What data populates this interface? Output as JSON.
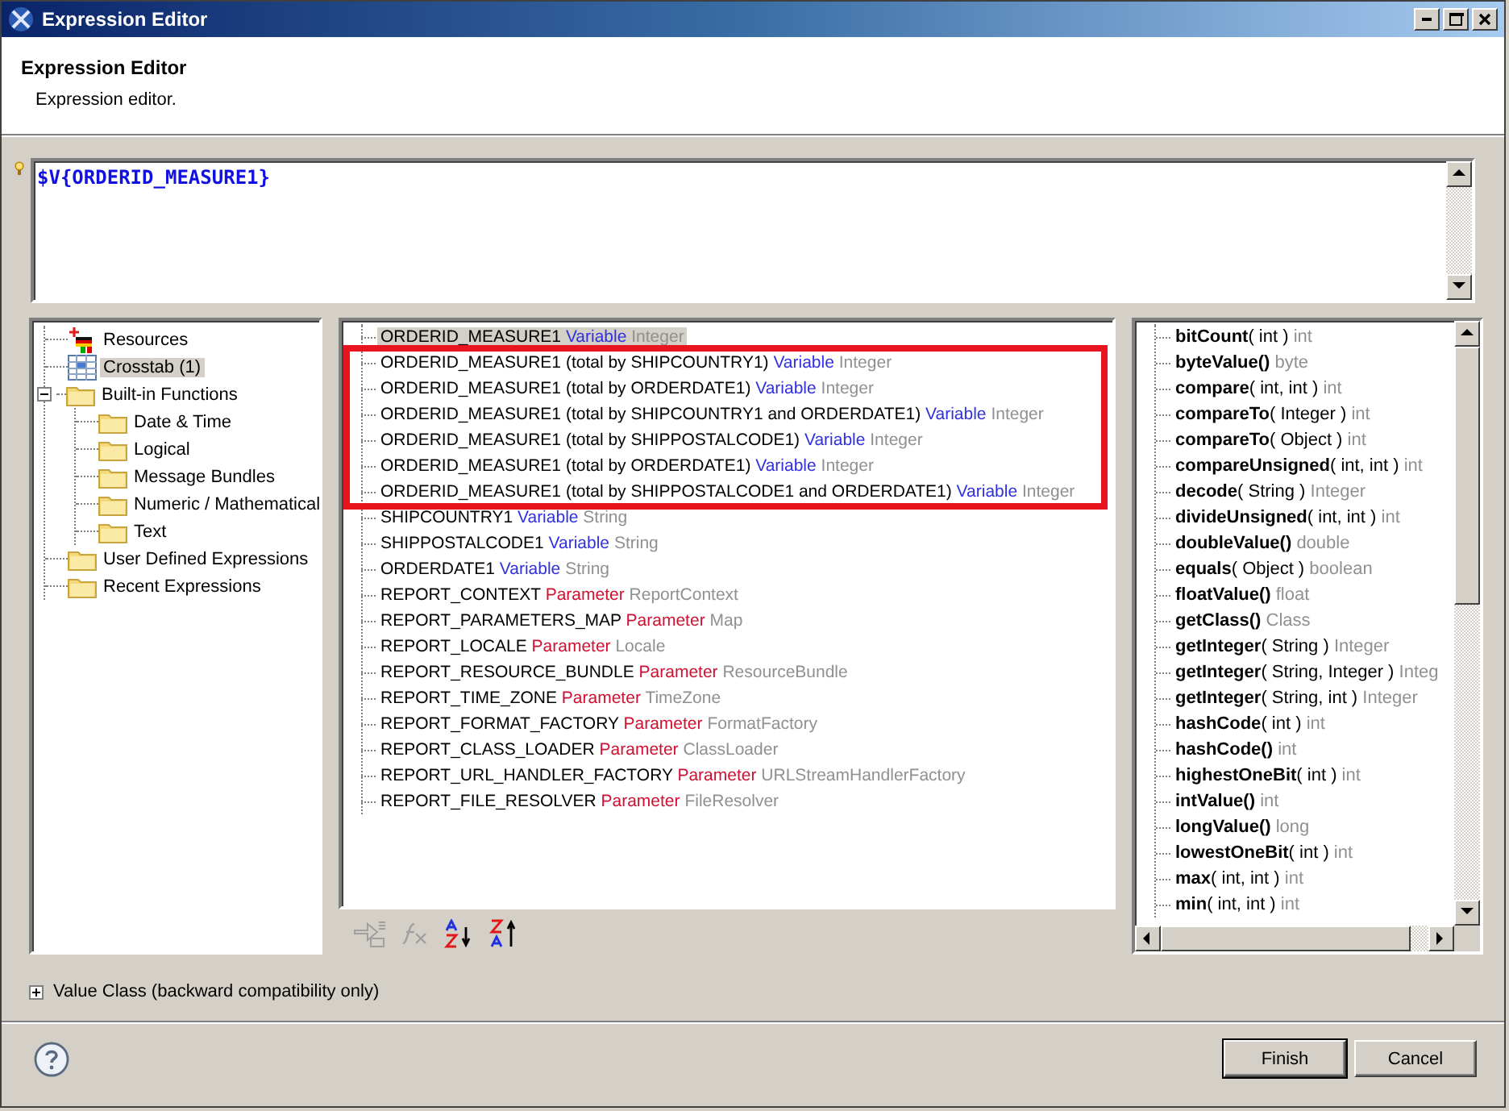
{
  "window": {
    "title": "Expression Editor"
  },
  "header": {
    "title": "Expression Editor",
    "description": "Expression editor."
  },
  "expression": {
    "value": "$V{ORDERID_MEASURE1}"
  },
  "categories": [
    {
      "label": "Resources",
      "kind": "resources",
      "selected": false
    },
    {
      "label": "Crosstab (1)",
      "kind": "crosstab",
      "selected": true
    },
    {
      "label": "Built-in Functions",
      "kind": "folder",
      "selected": false,
      "expanded": true,
      "children": [
        {
          "label": "Date & Time",
          "kind": "folder",
          "selected": false
        },
        {
          "label": "Logical",
          "kind": "folder",
          "selected": false
        },
        {
          "label": "Message Bundles",
          "kind": "folder",
          "selected": false
        },
        {
          "label": "Numeric / Mathematical",
          "kind": "folder",
          "selected": false
        },
        {
          "label": "Text",
          "kind": "folder",
          "selected": false
        }
      ]
    },
    {
      "label": "User Defined Expressions",
      "kind": "folder",
      "selected": false
    },
    {
      "label": "Recent Expressions",
      "kind": "folder",
      "selected": false
    }
  ],
  "objects": [
    {
      "name": "ORDERID_MEASURE1",
      "category": "Variable",
      "kind": "variable",
      "type": "Integer",
      "selected": true,
      "highlighted": false
    },
    {
      "name": "ORDERID_MEASURE1 (total by SHIPCOUNTRY1)",
      "category": "Variable",
      "kind": "variable",
      "type": "Integer",
      "selected": false,
      "highlighted": true
    },
    {
      "name": "ORDERID_MEASURE1 (total by ORDERDATE1)",
      "category": "Variable",
      "kind": "variable",
      "type": "Integer",
      "selected": false,
      "highlighted": true
    },
    {
      "name": "ORDERID_MEASURE1 (total by SHIPCOUNTRY1 and ORDERDATE1)",
      "category": "Variable",
      "kind": "variable",
      "type": "Integer",
      "selected": false,
      "highlighted": true
    },
    {
      "name": "ORDERID_MEASURE1 (total by SHIPPOSTALCODE1)",
      "category": "Variable",
      "kind": "variable",
      "type": "Integer",
      "selected": false,
      "highlighted": true
    },
    {
      "name": "ORDERID_MEASURE1 (total by ORDERDATE1)",
      "category": "Variable",
      "kind": "variable",
      "type": "Integer",
      "selected": false,
      "highlighted": true
    },
    {
      "name": "ORDERID_MEASURE1 (total by SHIPPOSTALCODE1 and ORDERDATE1)",
      "category": "Variable",
      "kind": "variable",
      "type": "Integer",
      "selected": false,
      "highlighted": true
    },
    {
      "name": "SHIPCOUNTRY1",
      "category": "Variable",
      "kind": "variable",
      "type": "String",
      "selected": false,
      "highlighted": false
    },
    {
      "name": "SHIPPOSTALCODE1",
      "category": "Variable",
      "kind": "variable",
      "type": "String",
      "selected": false,
      "highlighted": false
    },
    {
      "name": "ORDERDATE1",
      "category": "Variable",
      "kind": "variable",
      "type": "String",
      "selected": false,
      "highlighted": false
    },
    {
      "name": "REPORT_CONTEXT",
      "category": "Parameter",
      "kind": "parameter",
      "type": "ReportContext",
      "selected": false,
      "highlighted": false
    },
    {
      "name": "REPORT_PARAMETERS_MAP",
      "category": "Parameter",
      "kind": "parameter",
      "type": "Map",
      "selected": false,
      "highlighted": false
    },
    {
      "name": "REPORT_LOCALE",
      "category": "Parameter",
      "kind": "parameter",
      "type": "Locale",
      "selected": false,
      "highlighted": false
    },
    {
      "name": "REPORT_RESOURCE_BUNDLE",
      "category": "Parameter",
      "kind": "parameter",
      "type": "ResourceBundle",
      "selected": false,
      "highlighted": false
    },
    {
      "name": "REPORT_TIME_ZONE",
      "category": "Parameter",
      "kind": "parameter",
      "type": "TimeZone",
      "selected": false,
      "highlighted": false
    },
    {
      "name": "REPORT_FORMAT_FACTORY",
      "category": "Parameter",
      "kind": "parameter",
      "type": "FormatFactory",
      "selected": false,
      "highlighted": false
    },
    {
      "name": "REPORT_CLASS_LOADER",
      "category": "Parameter",
      "kind": "parameter",
      "type": "ClassLoader",
      "selected": false,
      "highlighted": false
    },
    {
      "name": "REPORT_URL_HANDLER_FACTORY",
      "category": "Parameter",
      "kind": "parameter",
      "type": "URLStreamHandlerFactory",
      "selected": false,
      "highlighted": false
    },
    {
      "name": "REPORT_FILE_RESOLVER",
      "category": "Parameter",
      "kind": "parameter",
      "type": "FileResolver",
      "selected": false,
      "highlighted": false
    }
  ],
  "methods": [
    {
      "name": "bitCount",
      "params": "( int )",
      "returns": "int"
    },
    {
      "name": "byteValue()",
      "returns": "byte"
    },
    {
      "name": "compare",
      "params": "( int, int )",
      "returns": "int"
    },
    {
      "name": "compareTo",
      "params": "( Integer )",
      "returns": "int"
    },
    {
      "name": "compareTo",
      "params": "( Object )",
      "returns": "int"
    },
    {
      "name": "compareUnsigned",
      "params": "( int, int )",
      "returns": "int"
    },
    {
      "name": "decode",
      "params": "( String )",
      "returns": "Integer"
    },
    {
      "name": "divideUnsigned",
      "params": "( int, int )",
      "returns": "int"
    },
    {
      "name": "doubleValue()",
      "returns": "double"
    },
    {
      "name": "equals",
      "params": "( Object )",
      "returns": "boolean"
    },
    {
      "name": "floatValue()",
      "returns": "float"
    },
    {
      "name": "getClass()",
      "returns": "Class"
    },
    {
      "name": "getInteger",
      "params": "( String )",
      "returns": "Integer"
    },
    {
      "name": "getInteger",
      "params": "( String, Integer )",
      "returns": "Integ"
    },
    {
      "name": "getInteger",
      "params": "( String, int )",
      "returns": "Integer"
    },
    {
      "name": "hashCode",
      "params": "( int )",
      "returns": "int"
    },
    {
      "name": "hashCode()",
      "returns": "int"
    },
    {
      "name": "highestOneBit",
      "params": "( int )",
      "returns": "int"
    },
    {
      "name": "intValue()",
      "returns": "int"
    },
    {
      "name": "longValue()",
      "returns": "long"
    },
    {
      "name": "lowestOneBit",
      "params": "( int )",
      "returns": "int"
    },
    {
      "name": "max",
      "params": "( int, int )",
      "returns": "int"
    },
    {
      "name": "min",
      "params": "( int, int )",
      "returns": "int"
    }
  ],
  "value_class": {
    "label": "Value Class (backward compatibility only)",
    "expanded": false
  },
  "buttons": [
    {
      "label": "Finish",
      "default": true
    },
    {
      "label": "Cancel",
      "default": false
    }
  ]
}
